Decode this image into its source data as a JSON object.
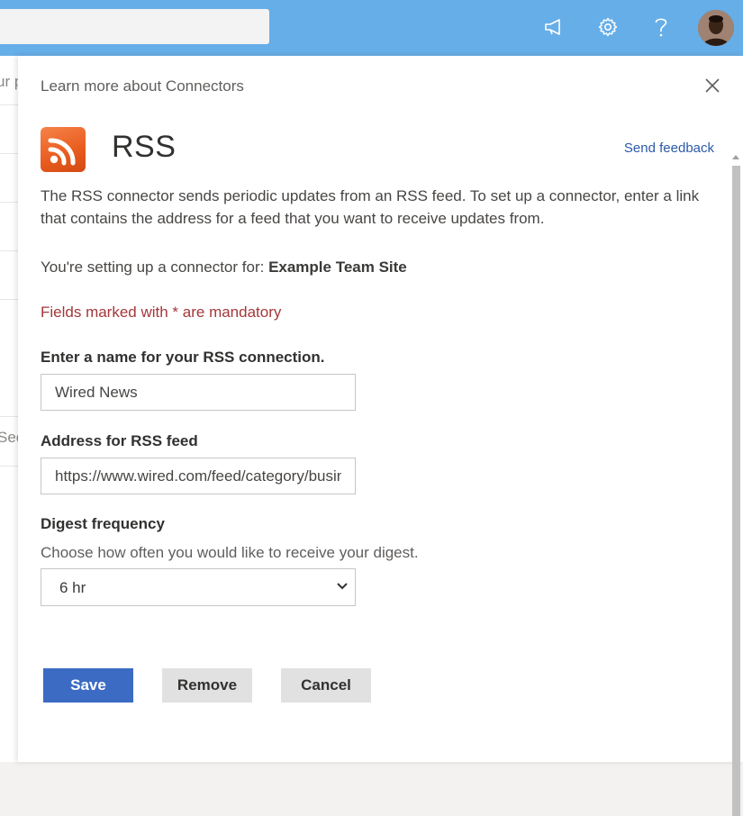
{
  "panel": {
    "learn_more": "Learn more about Connectors",
    "title": "RSS",
    "send_feedback": "Send feedback",
    "description": "The RSS connector sends periodic updates from an RSS feed. To set up a connector, enter a link that contains the address for a feed that you want to receive updates from.",
    "setup_prefix": "You're setting up a connector for: ",
    "site_name": "Example Team Site",
    "mandatory_note": "Fields marked with * are mandatory"
  },
  "form": {
    "name_label": "Enter a name for your RSS connection.",
    "name_value": "Wired News",
    "address_label": "Address for RSS feed",
    "address_value": "https://www.wired.com/feed/category/business/latest/rss",
    "frequency_label": "Digest frequency",
    "frequency_hint": "Choose how often you would like to receive your digest.",
    "frequency_value": "6 hr"
  },
  "buttons": {
    "save": "Save",
    "remove": "Remove",
    "cancel": "Cancel"
  },
  "background": {
    "text_1": "ur p",
    "text_2": "See"
  },
  "colors": {
    "topbar": "#66aee8",
    "primary": "#3b6bc3",
    "mandatory": "#a4373a",
    "link": "#2b5aa8"
  },
  "icons": [
    "megaphone-icon",
    "gear-icon",
    "help-icon",
    "close-icon",
    "rss-icon",
    "chevron-down-icon"
  ]
}
